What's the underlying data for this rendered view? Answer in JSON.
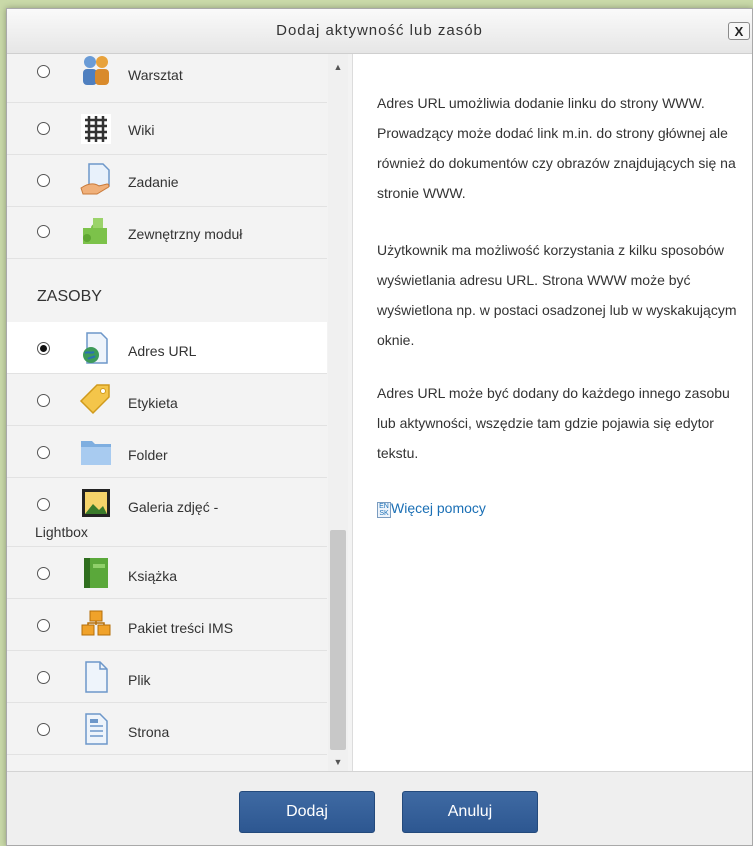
{
  "dialog": {
    "title": "Dodaj aktywność lub zasób",
    "close_label": "X"
  },
  "list": {
    "activities": [
      {
        "label": "Warsztat",
        "icon": "workshop-icon"
      },
      {
        "label": "Wiki",
        "icon": "wiki-icon"
      },
      {
        "label": "Zadanie",
        "icon": "assignment-icon"
      },
      {
        "label": "Zewnętrzny moduł",
        "icon": "puzzle-icon"
      }
    ],
    "resources_heading": "ZASOBY",
    "resources": [
      {
        "label": "Adres URL",
        "icon": "url-icon",
        "selected": true
      },
      {
        "label": "Etykieta",
        "icon": "label-tag-icon"
      },
      {
        "label": "Folder",
        "icon": "folder-icon"
      },
      {
        "label": "Galeria zdjęć -",
        "label2": "Lightbox",
        "icon": "image-gallery-icon"
      },
      {
        "label": "Książka",
        "icon": "book-icon"
      },
      {
        "label": "Pakiet treści IMS",
        "icon": "ims-package-icon"
      },
      {
        "label": "Plik",
        "icon": "file-icon"
      },
      {
        "label": "Strona",
        "icon": "page-icon"
      }
    ]
  },
  "help": {
    "paragraphs": [
      "Adres URL umożliwia dodanie linku do strony WWW. Prowadzący może dodać link m.in. do strony głównej ale również do dokumentów czy obrazów znajdujących się na stronie WWW.",
      "Użytkownik ma możliwość korzystania z kilku sposobów wyświetlania adresu URL. Strona WWW może być wyświetlona np. w postaci osadzonej lub w wyskakującym oknie.",
      "Adres URL może być dodany do każdego innego zasobu lub aktywności, wszędzie tam gdzie pojawia się edytor tekstu."
    ],
    "more_help": "Więcej pomocy"
  },
  "buttons": {
    "add": "Dodaj",
    "cancel": "Anuluj"
  },
  "colors": {
    "button": "#2d5791",
    "link": "#1a6fb5",
    "page_bg": "#c9d9a8"
  }
}
